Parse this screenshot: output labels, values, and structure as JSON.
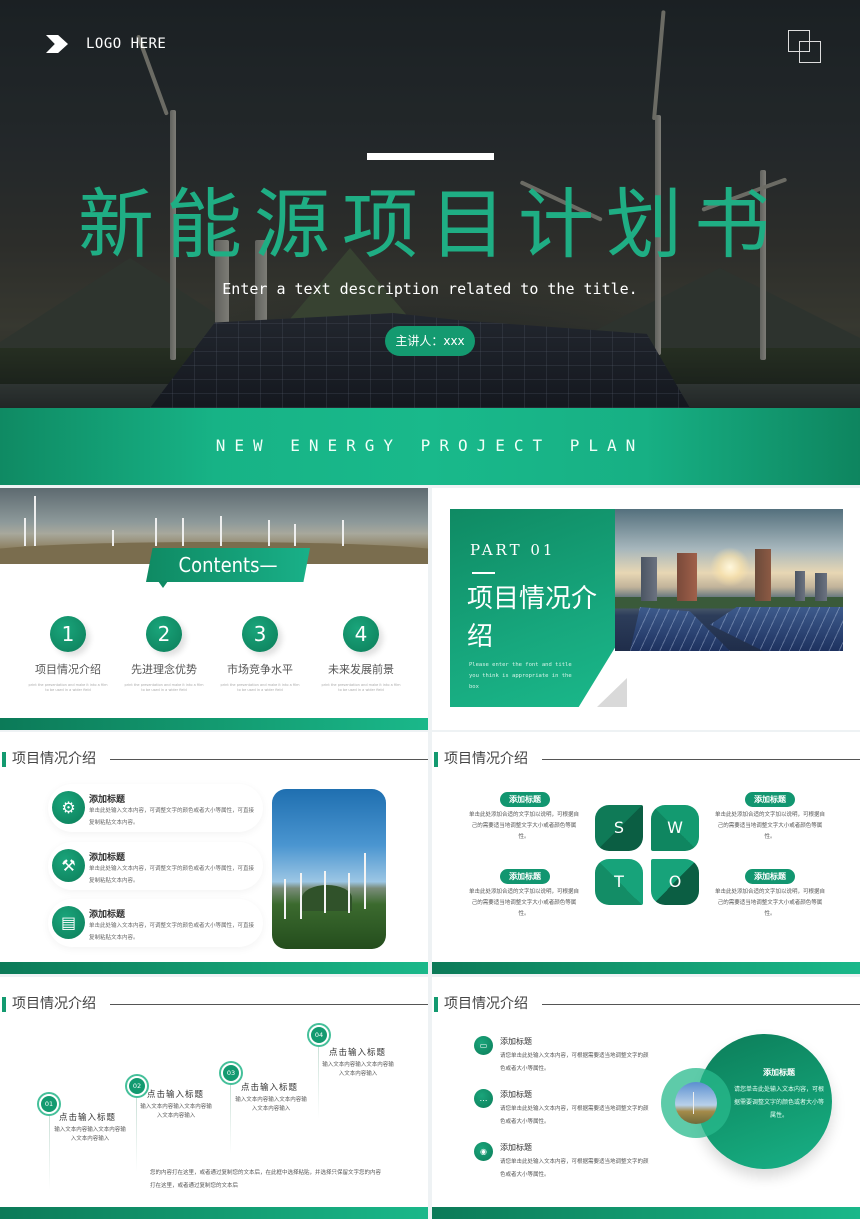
{
  "hero": {
    "logo_text": "LOGO HERE",
    "title": "新能源项目计划书",
    "subtitle": "Enter a text description related to the title.",
    "presenter": "主讲人：xxx",
    "band_text": "NEW ENERGY PROJECT PLAN",
    "colors": {
      "accent": "#1fae84",
      "band": "#17b386"
    }
  },
  "contents": {
    "banner": "Contents—",
    "items": [
      {
        "num": "1",
        "label": "项目情况介绍",
        "desc": "print the presentation and make it into a film to be used in a wider field"
      },
      {
        "num": "2",
        "label": "先进理念优势",
        "desc": "print the presentation and make it into a film to be used in a wider field"
      },
      {
        "num": "3",
        "label": "市场竞争水平",
        "desc": "print the presentation and make it into a film to be used in a wider field"
      },
      {
        "num": "4",
        "label": "未来发展前景",
        "desc": "print the presentation and make it into a film to be used in a wider field"
      }
    ]
  },
  "part": {
    "label": "PART 01",
    "title": "项目情况介绍",
    "desc": "Please enter the font and title you think is appropriate in the box"
  },
  "section_title": "项目情况介绍",
  "features": {
    "items": [
      {
        "icon": "gear-icon",
        "glyph": "⚙",
        "title": "添加标题",
        "desc": "单击此处输入文本内容，可调整文字的颜色或者大小等属性，可直接复制粘贴文本内容。"
      },
      {
        "icon": "tools-icon",
        "glyph": "⚒",
        "title": "添加标题",
        "desc": "单击此处输入文本内容，可调整文字的颜色或者大小等属性，可直接复制粘贴文本内容。"
      },
      {
        "icon": "calendar-icon",
        "glyph": "▤",
        "title": "添加标题",
        "desc": "单击此处输入文本内容，可调整文字的颜色或者大小等属性，可直接复制粘贴文本内容。"
      }
    ]
  },
  "swot": {
    "letters": [
      "S",
      "W",
      "T",
      "O"
    ],
    "items": [
      {
        "title": "添加标题",
        "desc": "单击此处添加合适的文字加以说明，可根据自己的需要适当地调整文字大小或者颜色等属性。"
      },
      {
        "title": "添加标题",
        "desc": "单击此处添加合适的文字加以说明，可根据自己的需要适当地调整文字大小或者颜色等属性。"
      },
      {
        "title": "添加标题",
        "desc": "单击此处添加合适的文字加以说明，可根据自己的需要适当地调整文字大小或者颜色等属性。"
      },
      {
        "title": "添加标题",
        "desc": "单击此处添加合适的文字加以说明，可根据自己的需要适当地调整文字大小或者颜色等属性。"
      }
    ]
  },
  "timeline": {
    "steps": [
      {
        "num": "01",
        "title": "点击输入标题",
        "desc": "输入文本内容输入文本内容输入文本内容输入"
      },
      {
        "num": "02",
        "title": "点击输入标题",
        "desc": "输入文本内容输入文本内容输入文本内容输入"
      },
      {
        "num": "03",
        "title": "点击输入标题",
        "desc": "输入文本内容输入文本内容输入文本内容输入"
      },
      {
        "num": "04",
        "title": "点击输入标题",
        "desc": "输入文本内容输入文本内容输入文本内容输入"
      }
    ],
    "note": "您的内容打在这里，或者通过复制您的文本后，在此框中选择粘贴，并选择只保留文字您的内容打在这里，或者通过复制您的文本后"
  },
  "circles": {
    "items": [
      {
        "icon": "briefcase-icon",
        "glyph": "▭",
        "title": "添加标题",
        "desc": "请您单击此处输入文本内容，可根据需要适当地调整文字的颜色或者大小等属性。"
      },
      {
        "icon": "message-icon",
        "glyph": "…",
        "title": "添加标题",
        "desc": "请您单击此处输入文本内容，可根据需要适当地调整文字的颜色或者大小等属性。"
      },
      {
        "icon": "location-icon",
        "glyph": "◉",
        "title": "添加标题",
        "desc": "请您单击此处输入文本内容，可根据需要适当地调整文字的颜色或者大小等属性。"
      }
    ],
    "big": {
      "title": "添加标题",
      "desc": "请您单击此处输入文本内容，可根据需要调整文字的颜色或者大小等属性。"
    }
  }
}
